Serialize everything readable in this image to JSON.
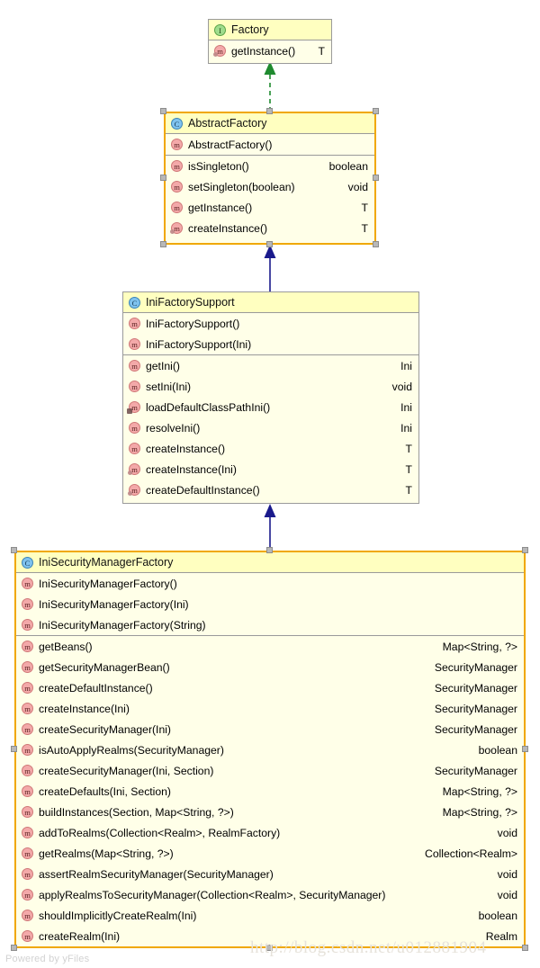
{
  "diagram": {
    "type": "uml-class-diagram",
    "tool_watermark": "Powered by yFiles",
    "url_watermark": "http://blog.csdn.net/u012881904",
    "colors": {
      "box_body": "#ffffe8",
      "box_header": "#ffffc0",
      "selected_border": "#f0a800",
      "plain_border": "#9a9a9a",
      "generalization_arrow": "#1a1a8c",
      "realization_arrow": "#1f8a2f",
      "interface_icon": "#9fdc8c",
      "class_icon": "#7fc2ee",
      "method_icon": "#f3a9a9"
    }
  },
  "classes": [
    {
      "id": "factory",
      "name": "Factory",
      "stereotype": "interface",
      "icon": "interface-icon",
      "selected": false,
      "constructors": [],
      "methods": [
        {
          "name": "getInstance()",
          "type": "T",
          "icon": "method-icon",
          "modifier": "abstract"
        }
      ]
    },
    {
      "id": "abstract-factory",
      "name": "AbstractFactory",
      "stereotype": "class",
      "icon": "class-icon",
      "selected": true,
      "constructors": [
        {
          "name": "AbstractFactory()",
          "type": "",
          "icon": "method-icon",
          "modifier": "none"
        }
      ],
      "methods": [
        {
          "name": "isSingleton()",
          "type": "boolean",
          "icon": "method-icon",
          "modifier": "none"
        },
        {
          "name": "setSingleton(boolean)",
          "type": "void",
          "icon": "method-icon",
          "modifier": "none"
        },
        {
          "name": "getInstance()",
          "type": "T",
          "icon": "method-icon",
          "modifier": "none"
        },
        {
          "name": "createInstance()",
          "type": "T",
          "icon": "method-icon",
          "modifier": "abstract"
        }
      ]
    },
    {
      "id": "ini-factory-support",
      "name": "IniFactorySupport",
      "stereotype": "class",
      "icon": "class-icon",
      "selected": false,
      "constructors": [
        {
          "name": "IniFactorySupport()",
          "type": "",
          "icon": "method-icon",
          "modifier": "none"
        },
        {
          "name": "IniFactorySupport(Ini)",
          "type": "",
          "icon": "method-icon",
          "modifier": "none"
        }
      ],
      "methods": [
        {
          "name": "getIni()",
          "type": "Ini",
          "icon": "method-icon",
          "modifier": "none"
        },
        {
          "name": "setIni(Ini)",
          "type": "void",
          "icon": "method-icon",
          "modifier": "none"
        },
        {
          "name": "loadDefaultClassPathIni()",
          "type": "Ini",
          "icon": "method-icon",
          "modifier": "static"
        },
        {
          "name": "resolveIni()",
          "type": "Ini",
          "icon": "method-icon",
          "modifier": "none"
        },
        {
          "name": "createInstance()",
          "type": "T",
          "icon": "method-icon",
          "modifier": "none"
        },
        {
          "name": "createInstance(Ini)",
          "type": "T",
          "icon": "method-icon",
          "modifier": "abstract"
        },
        {
          "name": "createDefaultInstance()",
          "type": "T",
          "icon": "method-icon",
          "modifier": "abstract"
        }
      ]
    },
    {
      "id": "ini-security-manager-factory",
      "name": "IniSecurityManagerFactory",
      "stereotype": "class",
      "icon": "class-icon",
      "selected": true,
      "constructors": [
        {
          "name": "IniSecurityManagerFactory()",
          "type": "",
          "icon": "method-icon",
          "modifier": "none"
        },
        {
          "name": "IniSecurityManagerFactory(Ini)",
          "type": "",
          "icon": "method-icon",
          "modifier": "none"
        },
        {
          "name": "IniSecurityManagerFactory(String)",
          "type": "",
          "icon": "method-icon",
          "modifier": "none"
        }
      ],
      "methods": [
        {
          "name": "getBeans()",
          "type": "Map<String, ?>",
          "icon": "method-icon",
          "modifier": "none"
        },
        {
          "name": "getSecurityManagerBean()",
          "type": "SecurityManager",
          "icon": "method-icon",
          "modifier": "none"
        },
        {
          "name": "createDefaultInstance()",
          "type": "SecurityManager",
          "icon": "method-icon",
          "modifier": "none"
        },
        {
          "name": "createInstance(Ini)",
          "type": "SecurityManager",
          "icon": "method-icon",
          "modifier": "none"
        },
        {
          "name": "createSecurityManager(Ini)",
          "type": "SecurityManager",
          "icon": "method-icon",
          "modifier": "none"
        },
        {
          "name": "isAutoApplyRealms(SecurityManager)",
          "type": "boolean",
          "icon": "method-icon",
          "modifier": "none"
        },
        {
          "name": "createSecurityManager(Ini, Section)",
          "type": "SecurityManager",
          "icon": "method-icon",
          "modifier": "none"
        },
        {
          "name": "createDefaults(Ini, Section)",
          "type": "Map<String, ?>",
          "icon": "method-icon",
          "modifier": "none"
        },
        {
          "name": "buildInstances(Section, Map<String, ?>)",
          "type": "Map<String, ?>",
          "icon": "method-icon",
          "modifier": "none"
        },
        {
          "name": "addToRealms(Collection<Realm>, RealmFactory)",
          "type": "void",
          "icon": "method-icon",
          "modifier": "none"
        },
        {
          "name": "getRealms(Map<String, ?>)",
          "type": "Collection<Realm>",
          "icon": "method-icon",
          "modifier": "none"
        },
        {
          "name": "assertRealmSecurityManager(SecurityManager)",
          "type": "void",
          "icon": "method-icon",
          "modifier": "none"
        },
        {
          "name": "applyRealmsToSecurityManager(Collection<Realm>, SecurityManager)",
          "type": "void",
          "icon": "method-icon",
          "modifier": "none"
        },
        {
          "name": "shouldImplicitlyCreateRealm(Ini)",
          "type": "boolean",
          "icon": "method-icon",
          "modifier": "none"
        },
        {
          "name": "createRealm(Ini)",
          "type": "Realm",
          "icon": "method-icon",
          "modifier": "none"
        }
      ]
    }
  ],
  "relations": [
    {
      "from": "abstract-factory",
      "to": "factory",
      "kind": "realization",
      "style": "dashed",
      "arrow": "hollow-triangle",
      "color": "#1f8a2f"
    },
    {
      "from": "ini-factory-support",
      "to": "abstract-factory",
      "kind": "generalization",
      "style": "solid",
      "arrow": "filled-triangle",
      "color": "#1a1a8c"
    },
    {
      "from": "ini-security-manager-factory",
      "to": "ini-factory-support",
      "kind": "generalization",
      "style": "solid",
      "arrow": "filled-triangle",
      "color": "#1a1a8c"
    }
  ],
  "icon_glyphs": {
    "interface-icon": "I",
    "class-icon": "C",
    "method-icon": "m"
  }
}
